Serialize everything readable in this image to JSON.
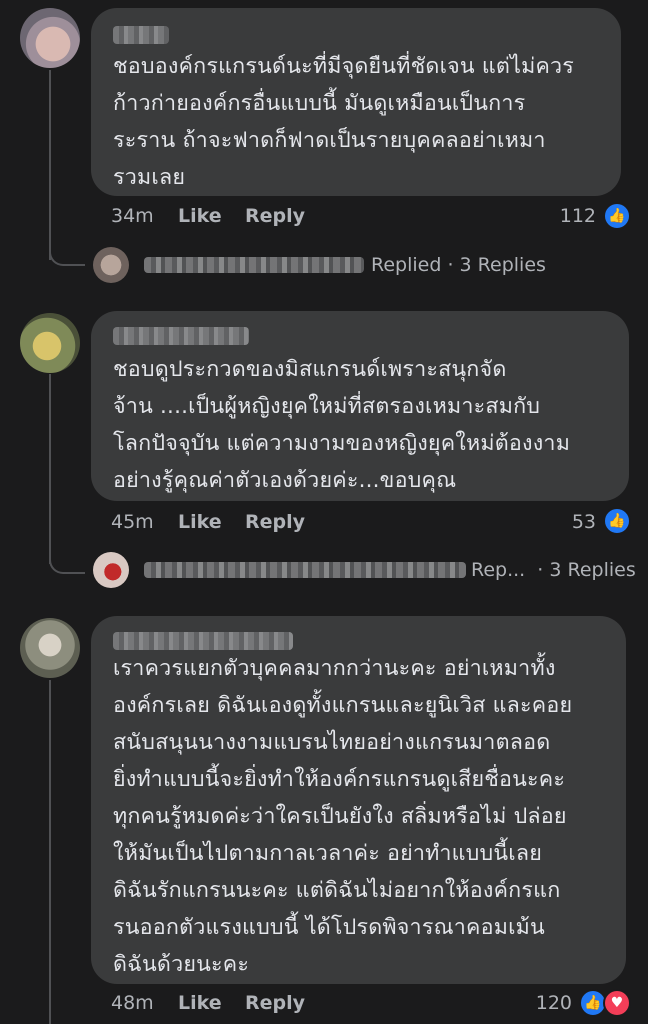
{
  "comments": [
    {
      "text": "ชอบองค์กรแกรนด์นะที่มีจุดยืนที่ชัดเจน แต่ไม่ควร\nก้าวก่ายองค์กรอื่นแบบนี้ มันดูเหมือนเป็นการ\nระราน ถ้าจะฟาดก็ฟาดเป็นรายบุคคลอย่าเหมา\nรวมเลย",
      "time": "34m",
      "like_label": "Like",
      "reply_label": "Reply",
      "reaction_count": "112",
      "replies": {
        "status": "Replied",
        "count_text": "· 3 Replies"
      }
    },
    {
      "text": "ชอบดูประกวดของมิสแกรนด์เพราะสนุกจัด\nจ้าน ....เป็นผู้หญิงยุคใหม่ที่สตรองเหมาะสมกับ\nโลกปัจจุบัน แต่ความงามของหญิงยุคใหม่ต้องงาม\nอย่างรู้คุณค่าตัวเองด้วยค่ะ...ขอบคุณ",
      "time": "45m",
      "like_label": "Like",
      "reply_label": "Reply",
      "reaction_count": "53",
      "replies": {
        "status": "Rep...",
        "count_text": "· 3 Replies"
      }
    },
    {
      "text": "เราควรแยกตัวบุคคลมากกว่านะคะ อย่าเหมาทั้ง\nองค์กรเลย ดิฉันเองดูทั้งแกรนและยูนิเวิส และคอย\nสนับสนุนนางงามแบรนไทยอย่างแกรนมาตลอด\nยิ่งทำแบบนี้จะยิ่งทำให้องค์กรแกรนดูเสียชื่อนะคะ\nทุกคนรู้หมดค่ะว่าใครเป็นยังใง สลิ่มหรือไม่ ปล่อย\nให้มันเป็นไปตามกาลเวลาค่ะ อย่าทำแบบนี้เลย\nดิฉันรักแกรนนะคะ แต่ดิฉันไม่อยากให้องค์กรแก\nรนออกตัวแรงแบบนี้ ได้โปรดพิจารณาคอมเม้น\nดิฉันด้วยนะคะ",
      "time": "48m",
      "like_label": "Like",
      "reply_label": "Reply",
      "reaction_count": "120"
    }
  ],
  "icons": {
    "like": "thumbs-up-icon",
    "love": "heart-icon"
  },
  "colors": {
    "like": "#2078f4",
    "love": "#f33e58",
    "bubble": "#3a3b3c",
    "background": "#1b1b1c"
  }
}
